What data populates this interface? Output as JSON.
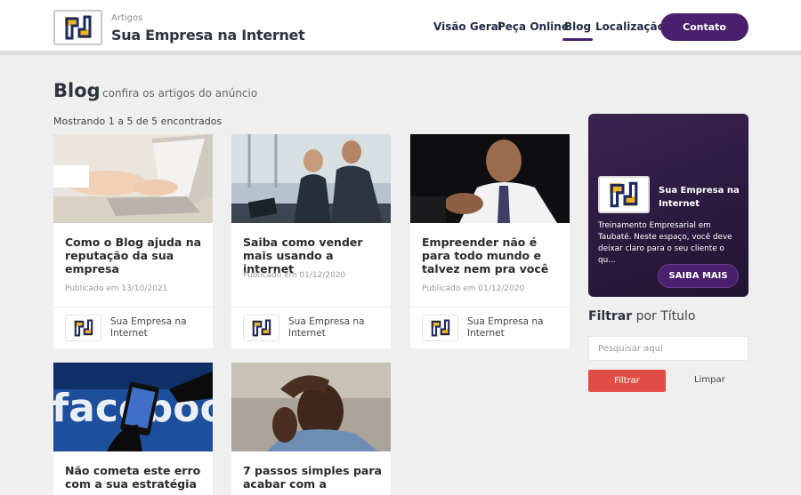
{
  "header": {
    "brand_sub": "Artigos",
    "brand_title": "Sua Empresa na Internet",
    "nav": [
      "Visão Geral",
      "Peça Online",
      "Blog",
      "Localização"
    ],
    "active_nav": "Blog",
    "contact_label": "Contato"
  },
  "page": {
    "title": "Blog",
    "subtitle": "confira os artigos do anúncio",
    "count_text": "Mostrando 1 a 5 de 5 encontrados"
  },
  "cards": [
    {
      "title": "Como o Blog ajuda na reputação da sua empresa",
      "date": "Publicado em 13/10/2021",
      "author": "Sua Empresa na Internet",
      "image": "laptop-hands-image"
    },
    {
      "title": "Saiba como vender mais usando a internet",
      "date": "Publicado em 01/12/2020",
      "author": "Sua Empresa na Internet",
      "image": "business-meeting-image"
    },
    {
      "title": "Empreender não é para todo mundo e talvez nem pra você",
      "date": "Publicado em 01/12/2020",
      "author": "Sua Empresa na Internet",
      "image": "businessman-pointing-image"
    },
    {
      "title": "Não cometa este erro com a sua estratégia",
      "image": "facebook-phone-image"
    },
    {
      "title": "7 passos simples para acabar com a",
      "image": "stressed-man-image"
    }
  ],
  "sidebar": {
    "promo_name": "Sua Empresa na Internet",
    "promo_text": "Treinamento Empresarial em Taubaté. Neste espaço, você deve deixar claro para o seu cliente o qu...",
    "promo_button": "SAIBA MAIS",
    "filter_title_bold": "Filtrar",
    "filter_title_rest": "por Título",
    "search_placeholder": "Pesquisar aqui",
    "filter_button": "Filtrar",
    "clear_button": "Limpar"
  },
  "colors": {
    "accent": "#4a1f6e",
    "filter_button": "#e14d45",
    "logo_yellow": "#f2b51f",
    "logo_navy": "#1f2a5c"
  }
}
